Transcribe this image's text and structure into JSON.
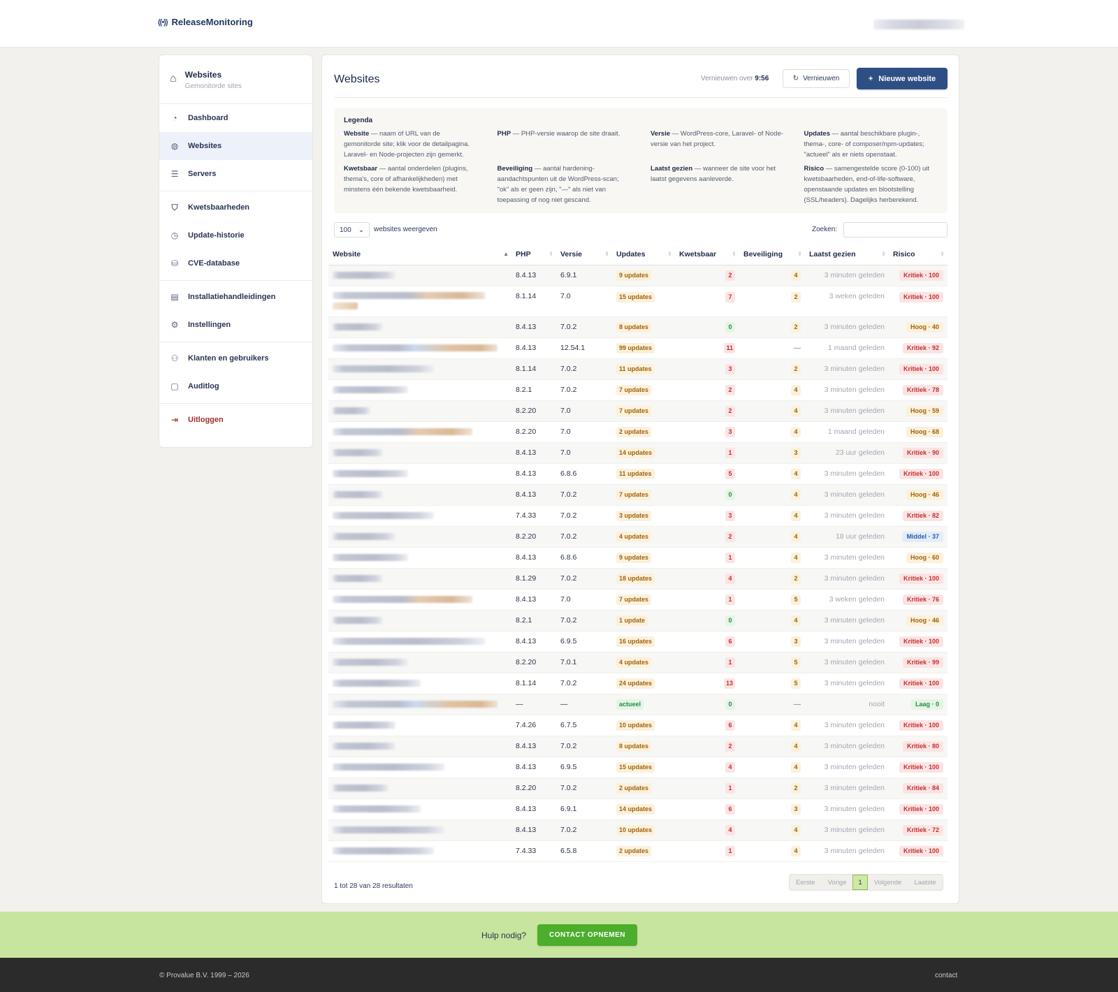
{
  "header": {
    "brand_icon": "((•))",
    "brand": "ReleaseMonitoring"
  },
  "sidebar": {
    "title": "Websites",
    "subtitle": "Gemonitorde sites",
    "groups": [
      [
        {
          "label": "Dashboard",
          "icon": "gauge-icon"
        },
        {
          "label": "Websites",
          "icon": "globe-icon",
          "active": true
        },
        {
          "label": "Servers",
          "icon": "server-icon"
        }
      ],
      [
        {
          "label": "Kwetsbaarheden",
          "icon": "shield-icon"
        },
        {
          "label": "Update-historie",
          "icon": "clock-icon"
        },
        {
          "label": "CVE-database",
          "icon": "database-icon"
        }
      ],
      [
        {
          "label": "Installatiehandleidingen",
          "icon": "document-icon"
        },
        {
          "label": "Instellingen",
          "icon": "gear-icon"
        }
      ],
      [
        {
          "label": "Klanten en gebruikers",
          "icon": "users-icon"
        },
        {
          "label": "Auditlog",
          "icon": "clipboard-icon"
        }
      ],
      [
        {
          "label": "Uitloggen",
          "icon": "logout-icon",
          "logout": true
        }
      ]
    ]
  },
  "main": {
    "title": "Websites",
    "refresh_prefix": "Vernieuwen over",
    "refresh_time": "9:56",
    "refresh_button": "Vernieuwen",
    "new_button": "Nieuwe website",
    "legend_title": "Legenda",
    "legend": [
      {
        "term": "Website",
        "desc": " — naam of URL van de gemonitorde site; klik voor de detailpagina. Laravel- en Node-projecten zijn gemerkt."
      },
      {
        "term": "PHP",
        "desc": " — PHP-versie waarop de site draait."
      },
      {
        "term": "Versie",
        "desc": " — WordPress-core, Laravel- of Node-versie van het project."
      },
      {
        "term": "Updates",
        "desc": " — aantal beschikbare plugin-, thema-, core- of composer/npm-updates; \"actueel\" als er niets openstaat."
      },
      {
        "term": "Kwetsbaar",
        "desc": " — aantal onderdelen (plugins, thema's, core of afhankelijkheden) met minstens één bekende kwetsbaarheid."
      },
      {
        "term": "Beveiliging",
        "desc": " — aantal hardening-aandachtspunten uit de WordPress-scan; \"ok\" als er geen zijn, \"—\" als niet van toepassing of nog niet gescand."
      },
      {
        "term": "Laatst gezien",
        "desc": " — wanneer de site voor het laatst gegevens aanleverde."
      },
      {
        "term": "Risico",
        "desc": " — samengestelde score (0-100) uit kwetsbaarheden, end-of-life-software, openstaande updates en blootstelling (SSL/headers). Dagelijks herberekend."
      }
    ],
    "length_value": "100",
    "length_label": "websites weergeven",
    "search_label": "Zoeken:",
    "columns": [
      "Website",
      "PHP",
      "Versie",
      "Updates",
      "Kwetsbaar",
      "Beveiliging",
      "Laatst gezien",
      "Risico"
    ],
    "rows": [
      {
        "w": 90,
        "php": "8.4.13",
        "ver": "6.9.1",
        "upd": "9 updates",
        "kw": "2",
        "bev": "4",
        "seen": "3 minuten geleden",
        "risk": "Kritiek · 100",
        "lvl": "kritiek"
      },
      {
        "w": 218,
        "tone": "warm",
        "tall": true,
        "php": "8.1.14",
        "ver": "7.0",
        "upd": "15 updates",
        "kw": "7",
        "bev": "2",
        "seen": "3 weken geleden",
        "risk": "Kritiek · 100",
        "lvl": "kritiek"
      },
      {
        "w": 72,
        "php": "8.4.13",
        "ver": "7.0.2",
        "upd": "8 updates",
        "kw": "0",
        "bev": "2",
        "seen": "3 minuten geleden",
        "risk": "Hoog · 40",
        "lvl": "hoog"
      },
      {
        "w": 236,
        "tone": "mix",
        "php": "8.4.13",
        "ver": "12.54.1",
        "upd": "99 updates",
        "kw": "11",
        "bev": "—",
        "seen": "1 maand geleden",
        "risk": "Kritiek · 92",
        "lvl": "kritiek"
      },
      {
        "w": 145,
        "php": "8.1.14",
        "ver": "7.0.2",
        "upd": "11 updates",
        "kw": "3",
        "bev": "2",
        "seen": "3 minuten geleden",
        "risk": "Kritiek · 100",
        "lvl": "kritiek"
      },
      {
        "w": 108,
        "php": "8.2.1",
        "ver": "7.0.2",
        "upd": "7 updates",
        "kw": "2",
        "bev": "4",
        "seen": "3 minuten geleden",
        "risk": "Kritiek · 78",
        "lvl": "kritiek"
      },
      {
        "w": 54,
        "php": "8.2.20",
        "ver": "7.0",
        "upd": "7 updates",
        "kw": "2",
        "bev": "4",
        "seen": "3 minuten geleden",
        "risk": "Hoog · 59",
        "lvl": "hoog"
      },
      {
        "w": 200,
        "tone": "warm",
        "php": "8.2.20",
        "ver": "7.0",
        "upd": "2 updates",
        "kw": "3",
        "bev": "4",
        "seen": "1 maand geleden",
        "risk": "Hoog · 68",
        "lvl": "hoog"
      },
      {
        "w": 72,
        "php": "8.4.13",
        "ver": "7.0",
        "upd": "14 updates",
        "kw": "1",
        "bev": "3",
        "seen": "23 uur geleden",
        "risk": "Kritiek · 90",
        "lvl": "kritiek"
      },
      {
        "w": 108,
        "php": "8.4.13",
        "ver": "6.8.6",
        "upd": "11 updates",
        "kw": "5",
        "bev": "4",
        "seen": "3 minuten geleden",
        "risk": "Kritiek · 100",
        "lvl": "kritiek"
      },
      {
        "w": 72,
        "php": "8.4.13",
        "ver": "7.0.2",
        "upd": "7 updates",
        "kw": "0",
        "bev": "4",
        "seen": "3 minuten geleden",
        "risk": "Hoog · 46",
        "lvl": "hoog"
      },
      {
        "w": 145,
        "php": "7.4.33",
        "ver": "7.0.2",
        "upd": "3 updates",
        "kw": "3",
        "bev": "4",
        "seen": "3 minuten geleden",
        "risk": "Kritiek · 82",
        "lvl": "kritiek"
      },
      {
        "w": 90,
        "php": "8.2.20",
        "ver": "7.0.2",
        "upd": "4 updates",
        "kw": "2",
        "bev": "4",
        "seen": "18 uur geleden",
        "risk": "Middel · 37",
        "lvl": "middel"
      },
      {
        "w": 108,
        "php": "8.4.13",
        "ver": "6.8.6",
        "upd": "9 updates",
        "kw": "1",
        "bev": "4",
        "seen": "3 minuten geleden",
        "risk": "Hoog · 60",
        "lvl": "hoog"
      },
      {
        "w": 72,
        "php": "8.1.29",
        "ver": "7.0.2",
        "upd": "18 updates",
        "kw": "4",
        "bev": "2",
        "seen": "3 minuten geleden",
        "risk": "Kritiek · 100",
        "lvl": "kritiek"
      },
      {
        "w": 200,
        "tone": "warm",
        "php": "8.4.13",
        "ver": "7.0",
        "upd": "7 updates",
        "kw": "1",
        "bev": "5",
        "seen": "3 weken geleden",
        "risk": "Kritiek · 76",
        "lvl": "kritiek"
      },
      {
        "w": 72,
        "php": "8.2.1",
        "ver": "7.0.2",
        "upd": "1 update",
        "kw": "0",
        "bev": "4",
        "seen": "3 minuten geleden",
        "risk": "Hoog · 46",
        "lvl": "hoog"
      },
      {
        "w": 218,
        "php": "8.4.13",
        "ver": "6.9.5",
        "upd": "16 updates",
        "kw": "6",
        "bev": "3",
        "seen": "3 minuten geleden",
        "risk": "Kritiek · 100",
        "lvl": "kritiek"
      },
      {
        "w": 108,
        "php": "8.2.20",
        "ver": "7.0.1",
        "upd": "4 updates",
        "kw": "1",
        "bev": "5",
        "seen": "3 minuten geleden",
        "risk": "Kritiek · 99",
        "lvl": "kritiek"
      },
      {
        "w": 126,
        "php": "8.1.14",
        "ver": "7.0.2",
        "upd": "24 updates",
        "kw": "13",
        "bev": "5",
        "seen": "3 minuten geleden",
        "risk": "Kritiek · 100",
        "lvl": "kritiek"
      },
      {
        "w": 236,
        "tone": "mix",
        "php": "—",
        "ver": "—",
        "upd": "actueel",
        "kw": "0",
        "bev": "—",
        "seen": "nooit",
        "risk": "Laag · 0",
        "lvl": "laag"
      },
      {
        "w": 90,
        "php": "7.4.26",
        "ver": "6.7.5",
        "upd": "10 updates",
        "kw": "6",
        "bev": "4",
        "seen": "3 minuten geleden",
        "risk": "Kritiek · 100",
        "lvl": "kritiek"
      },
      {
        "w": 90,
        "php": "8.4.13",
        "ver": "7.0.2",
        "upd": "8 updates",
        "kw": "2",
        "bev": "4",
        "seen": "3 minuten geleden",
        "risk": "Kritiek · 80",
        "lvl": "kritiek"
      },
      {
        "w": 160,
        "php": "8.4.13",
        "ver": "6.9.5",
        "upd": "15 updates",
        "kw": "4",
        "bev": "4",
        "seen": "3 minuten geleden",
        "risk": "Kritiek · 100",
        "lvl": "kritiek"
      },
      {
        "w": 80,
        "php": "8.2.20",
        "ver": "7.0.2",
        "upd": "2 updates",
        "kw": "1",
        "bev": "2",
        "seen": "3 minuten geleden",
        "risk": "Kritiek · 84",
        "lvl": "kritiek"
      },
      {
        "w": 126,
        "php": "8.4.13",
        "ver": "6.9.1",
        "upd": "14 updates",
        "kw": "6",
        "bev": "3",
        "seen": "3 minuten geleden",
        "risk": "Kritiek · 100",
        "lvl": "kritiek"
      },
      {
        "w": 160,
        "php": "8.4.13",
        "ver": "7.0.2",
        "upd": "10 updates",
        "kw": "4",
        "bev": "4",
        "seen": "3 minuten geleden",
        "risk": "Kritiek · 72",
        "lvl": "kritiek"
      },
      {
        "w": 145,
        "php": "7.4.33",
        "ver": "6.5.8",
        "upd": "2 updates",
        "kw": "1",
        "bev": "4",
        "seen": "3 minuten geleden",
        "risk": "Kritiek · 100",
        "lvl": "kritiek"
      }
    ],
    "result_info": "1 tot 28 van 28 resultaten",
    "pager": {
      "first": "Eerste",
      "prev": "Vorige",
      "current": "1",
      "next": "Volgende",
      "last": "Laatste"
    }
  },
  "helpbar": {
    "label": "Hulp nodig?",
    "button": "CONTACT OPNEMEN"
  },
  "footer": {
    "copyright": "© Provalue B.V. 1999 – 2026",
    "contact": "contact"
  }
}
